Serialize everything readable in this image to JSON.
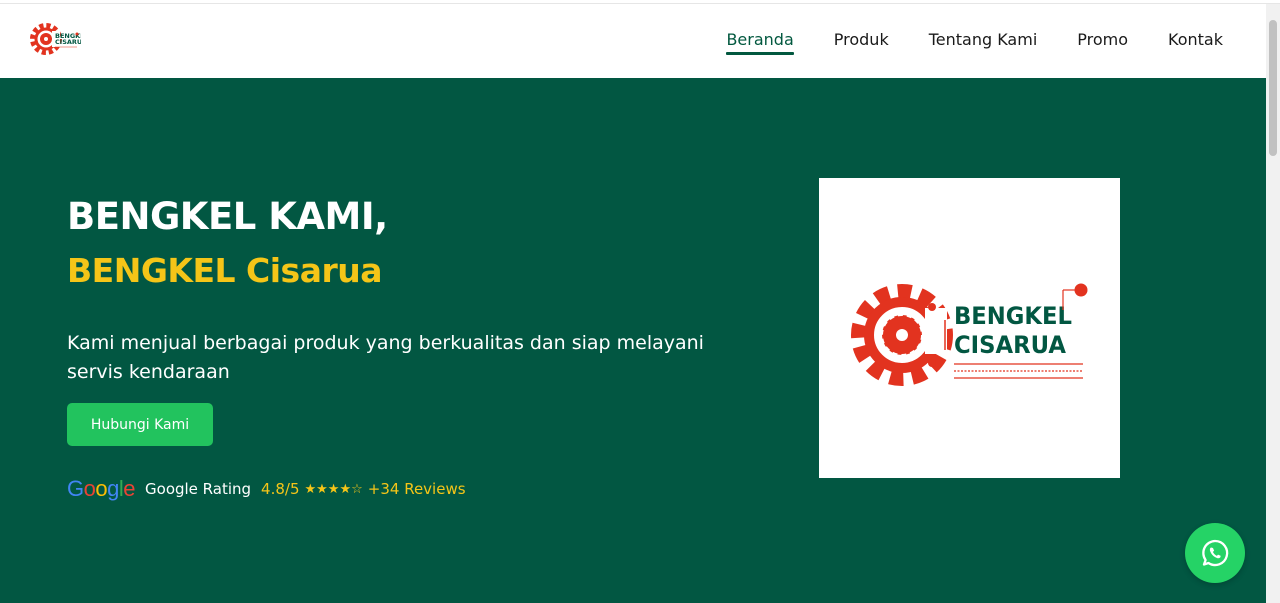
{
  "header": {
    "logo_text": [
      "BENGKEL",
      "CISARUA"
    ],
    "nav": [
      {
        "label": "Beranda",
        "active": true
      },
      {
        "label": "Produk",
        "active": false
      },
      {
        "label": "Tentang Kami",
        "active": false
      },
      {
        "label": "Promo",
        "active": false
      },
      {
        "label": "Kontak",
        "active": false
      }
    ]
  },
  "hero": {
    "title_line1": "BENGKEL KAMI,",
    "title_line2": "BENGKEL Cisarua",
    "description": "Kami menjual berbagai produk yang berkualitas dan siap melayani servis kendaraan",
    "cta_label": "Hubungi Kami",
    "rating": {
      "brand": "Google",
      "label": "Google Rating",
      "score": "4.8/5",
      "stars": "★★★★☆",
      "reviews": "+34 Reviews"
    }
  },
  "logo_card": {
    "line1": "BENGKEL",
    "line2": "CISARUA"
  },
  "icons": {
    "whatsapp": "whatsapp-icon",
    "logo": "gear-logo-icon"
  },
  "colors": {
    "brand_green": "#025742",
    "accent_yellow": "#f5c518",
    "cta_green": "#22c35e",
    "logo_red": "#e2331f",
    "whatsapp_green": "#25d366"
  }
}
